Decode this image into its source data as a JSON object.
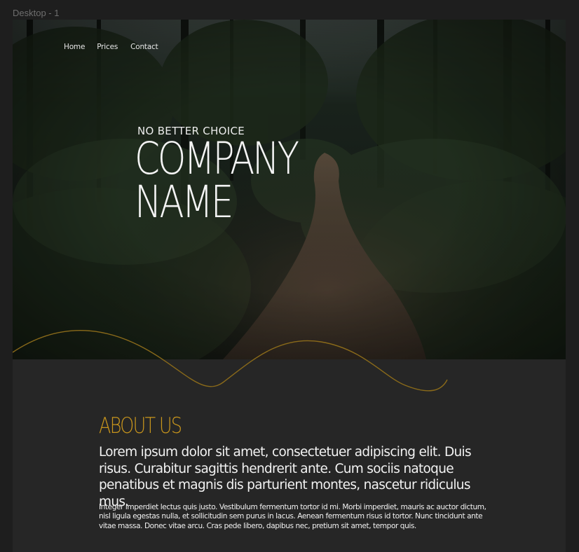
{
  "canvas": {
    "frame_label": "Desktop - 1"
  },
  "nav": {
    "items": [
      {
        "label": "Home"
      },
      {
        "label": "Prices"
      },
      {
        "label": "Contact"
      }
    ]
  },
  "hero": {
    "kicker": "NO BETTER CHOICE",
    "title_line1": "COMPANY",
    "title_line2": "NAME"
  },
  "about": {
    "title": "ABOUT US",
    "lead": "Lorem ipsum dolor sit amet, consectetuer adipiscing elit. Duis risus. Curabitur sagittis hendrerit ante. Cum sociis natoque penatibus et magnis dis parturient montes, nascetur ridiculus mus.",
    "body": "Integer imperdiet lectus quis justo. Vestibulum fermentum tortor id mi. Morbi imperdiet, mauris ac auctor dictum, nisl ligula egestas nulla, et sollicitudin sem purus in lacus. Aenean fermentum risus id tortor. Nunc tincidunt ante vitae massa. Donec vitae arcu. Cras pede libero, dapibus nec, pretium sit amet, tempor quis."
  },
  "colors": {
    "accent": "#c8951c",
    "frame_bg": "#262626",
    "canvas_bg": "#1e1e1e",
    "wave": "#8a6a1a"
  }
}
